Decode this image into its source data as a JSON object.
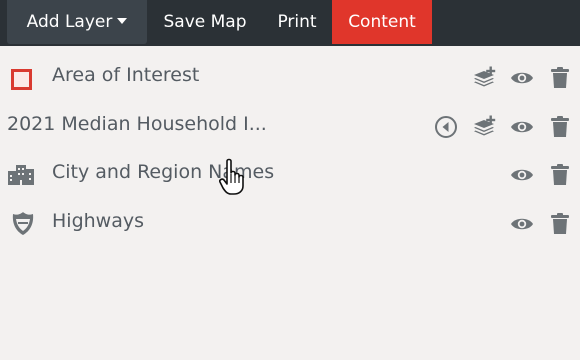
{
  "toolbar": {
    "add_layer_label": "Add Layer",
    "save_map_label": "Save Map",
    "print_label": "Print",
    "content_label": "Content",
    "content_color": "#e0362b"
  },
  "layers": [
    {
      "label": "Area of Interest",
      "leading_icon": "red-square-swatch",
      "actions": [
        "add-layer-icon",
        "visibility-eye-icon",
        "delete-trash-icon"
      ]
    },
    {
      "label": "2021 Median Household I...",
      "leading_icon": "none",
      "actions": [
        "legend-toggle-icon",
        "add-layer-icon",
        "visibility-eye-icon",
        "delete-trash-icon"
      ]
    },
    {
      "label": "City and Region Names",
      "leading_icon": "city-buildings-icon",
      "actions": [
        "visibility-eye-icon",
        "delete-trash-icon"
      ]
    },
    {
      "label": "Highways",
      "leading_icon": "highway-shield-icon",
      "actions": [
        "visibility-eye-icon",
        "delete-trash-icon"
      ]
    }
  ]
}
